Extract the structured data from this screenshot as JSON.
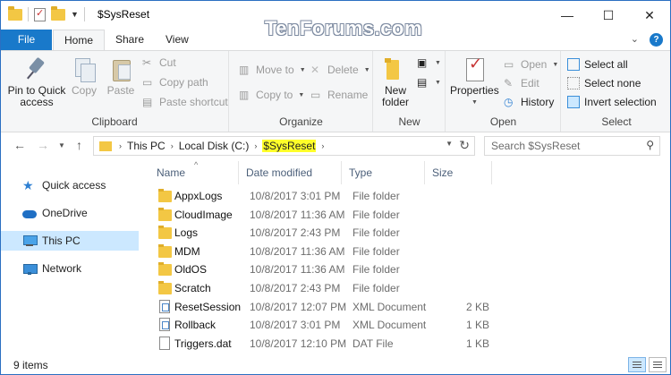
{
  "window": {
    "title": "$SysReset",
    "watermark": "TenForums.com"
  },
  "title_controls": {
    "minimize": "—",
    "maximize": "☐",
    "close": "✕"
  },
  "tabs": {
    "file": "File",
    "home": "Home",
    "share": "Share",
    "view": "View"
  },
  "ribbon": {
    "clipboard": {
      "label": "Clipboard",
      "pin": "Pin to Quick access",
      "copy": "Copy",
      "paste": "Paste",
      "cut": "Cut",
      "copy_path": "Copy path",
      "paste_shortcut": "Paste shortcut"
    },
    "organize": {
      "label": "Organize",
      "move_to": "Move to",
      "copy_to": "Copy to",
      "delete": "Delete",
      "rename": "Rename"
    },
    "new": {
      "label": "New",
      "new_folder": "New folder"
    },
    "open": {
      "label": "Open",
      "properties": "Properties",
      "open": "Open",
      "edit": "Edit",
      "history": "History"
    },
    "select": {
      "label": "Select",
      "select_all": "Select all",
      "select_none": "Select none",
      "invert": "Invert selection"
    }
  },
  "address": {
    "crumbs": [
      "This PC",
      "Local Disk (C:)",
      "$SysReset"
    ]
  },
  "search": {
    "placeholder": "Search $SysReset"
  },
  "navpane": {
    "items": [
      {
        "label": "Quick access",
        "icon": "star-icon"
      },
      {
        "label": "OneDrive",
        "icon": "cloud-icon"
      },
      {
        "label": "This PC",
        "icon": "pc-icon"
      },
      {
        "label": "Network",
        "icon": "network-icon"
      }
    ]
  },
  "columns": {
    "name": "Name",
    "date": "Date modified",
    "type": "Type",
    "size": "Size"
  },
  "files": [
    {
      "name": "AppxLogs",
      "date": "10/8/2017 3:01 PM",
      "type": "File folder",
      "size": "",
      "icon": "folder"
    },
    {
      "name": "CloudImage",
      "date": "10/8/2017 11:36 AM",
      "type": "File folder",
      "size": "",
      "icon": "folder"
    },
    {
      "name": "Logs",
      "date": "10/8/2017 2:43 PM",
      "type": "File folder",
      "size": "",
      "icon": "folder"
    },
    {
      "name": "MDM",
      "date": "10/8/2017 11:36 AM",
      "type": "File folder",
      "size": "",
      "icon": "folder"
    },
    {
      "name": "OldOS",
      "date": "10/8/2017 11:36 AM",
      "type": "File folder",
      "size": "",
      "icon": "folder"
    },
    {
      "name": "Scratch",
      "date": "10/8/2017 2:43 PM",
      "type": "File folder",
      "size": "",
      "icon": "folder"
    },
    {
      "name": "ResetSession",
      "date": "10/8/2017 12:07 PM",
      "type": "XML Document",
      "size": "2 KB",
      "icon": "xml"
    },
    {
      "name": "Rollback",
      "date": "10/8/2017 3:01 PM",
      "type": "XML Document",
      "size": "1 KB",
      "icon": "xml"
    },
    {
      "name": "Triggers.dat",
      "date": "10/8/2017 12:10 PM",
      "type": "DAT File",
      "size": "1 KB",
      "icon": "dat"
    }
  ],
  "status": {
    "count": "9 items"
  }
}
